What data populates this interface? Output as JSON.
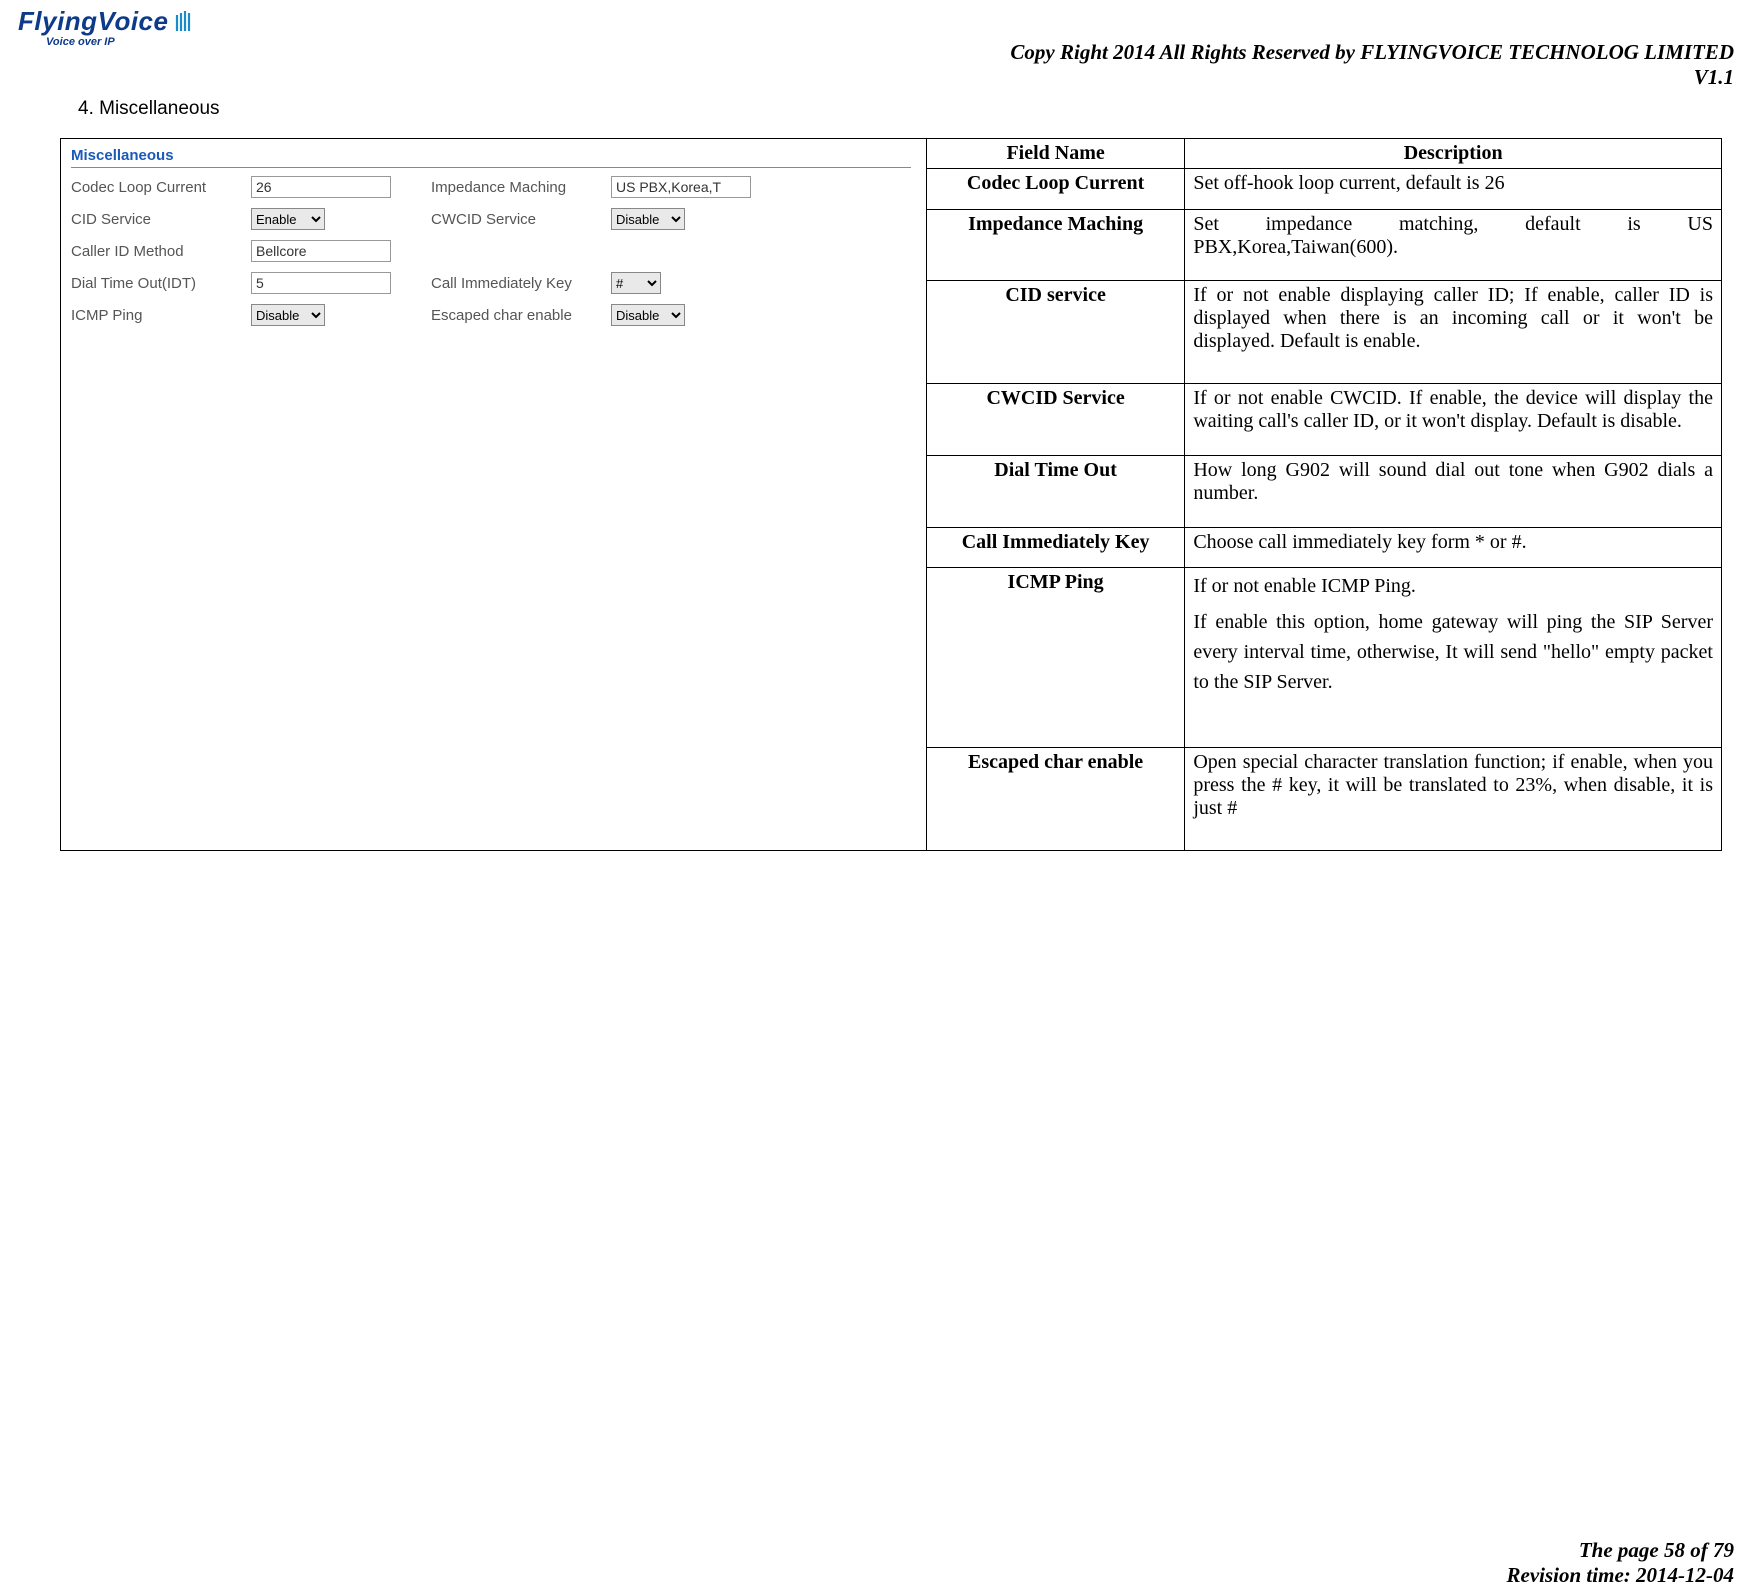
{
  "logo": {
    "brand": "FlyingVoice",
    "sub": "Voice over IP"
  },
  "header": {
    "copyright": "Copy Right 2014 All Rights Reserved by FLYINGVOICE TECHNOLOG LIMITED",
    "version": "V1.1"
  },
  "section": {
    "heading": "4.  Miscellaneous"
  },
  "screenshot": {
    "title": "Miscellaneous",
    "rows": [
      {
        "l1": "Codec Loop Current",
        "v1": "26",
        "t1": "text",
        "l2": "Impedance Maching",
        "v2": "US PBX,Korea,T",
        "t2": "text"
      },
      {
        "l1": "CID Service",
        "v1": "Enable",
        "t1": "select",
        "l2": "CWCID Service",
        "v2": "Disable",
        "t2": "select"
      },
      {
        "l1": "Caller ID Method",
        "v1": "Bellcore",
        "t1": "text",
        "l2": "",
        "v2": "",
        "t2": ""
      },
      {
        "l1": "Dial Time Out(IDT)",
        "v1": "5",
        "t1": "text",
        "l2": "Call Immediately Key",
        "v2": "#",
        "t2": "select-sm"
      },
      {
        "l1": "ICMP Ping",
        "v1": "Disable",
        "t1": "select",
        "l2": "Escaped char enable",
        "v2": "Disable",
        "t2": "select"
      }
    ]
  },
  "table": {
    "headers": [
      "Field Name",
      "Description"
    ],
    "rows": [
      {
        "field": "Codec Loop Current",
        "desc": "Set off-hook loop current, default is 26"
      },
      {
        "field": "Impedance Maching",
        "desc": "Set impedance matching, default is US PBX,Korea,Taiwan(600)."
      },
      {
        "field": "CID service",
        "desc": "If or not enable displaying caller ID; If enable, caller ID is displayed when there is an incoming call or it won't be displayed. Default is enable."
      },
      {
        "field": "CWCID Service",
        "desc": "If or not enable CWCID. If enable, the device will display the waiting call's caller ID, or it won't display. Default is disable."
      },
      {
        "field": "Dial Time Out",
        "desc": "How long G902 will sound dial out tone when G902 dials a number."
      },
      {
        "field": "Call Immediately Key",
        "desc": "Choose call immediately key form * or #."
      },
      {
        "field": "ICMP Ping",
        "desc": "If or not enable ICMP Ping.\nIf enable this option, home gateway will ping the SIP Server every interval time, otherwise, It will send \"hello\" empty packet to the SIP Server."
      },
      {
        "field": "Escaped char enable",
        "desc": "Open special character translation function; if enable, when you press the # key, it will be translated to 23%, when disable, it is just #"
      }
    ]
  },
  "footer": {
    "page": "The page 58 of 79",
    "rev": "Revision time: 2014-12-04"
  }
}
